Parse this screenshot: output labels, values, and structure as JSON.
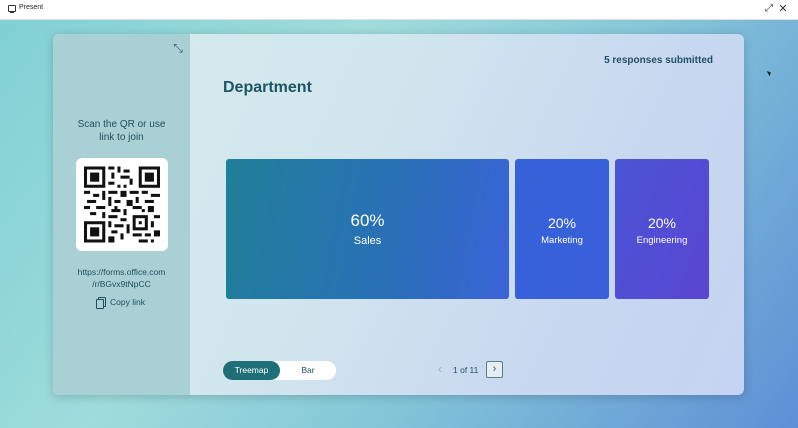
{
  "titlebar": {
    "title": "Present",
    "icons": [
      "present-icon",
      "expand-icon",
      "close-icon"
    ]
  },
  "sidebar": {
    "scan_line1": "Scan the QR or use",
    "scan_line2": "link to join",
    "link_line1": "https://forms.office.com",
    "link_line2": "/r/BGvx9tNpCC",
    "copy_label": "Copy link",
    "icons": [
      "collapse-icon",
      "copy-icon"
    ]
  },
  "main": {
    "responses": "5 responses submitted",
    "question": "Department",
    "tiles": [
      {
        "pct": "60%",
        "label": "Sales",
        "color": "#2a6fb8"
      },
      {
        "pct": "20%",
        "label": "Marketing",
        "color": "#3a5fda"
      },
      {
        "pct": "20%",
        "label": "Engineering",
        "color": "#5a45d2"
      }
    ],
    "toggle": {
      "treemap": "Treemap",
      "bar": "Bar",
      "selected": "Treemap"
    },
    "pager": {
      "text": "1 of 11",
      "icons": [
        "chevron-left-icon",
        "chevron-right-icon"
      ]
    }
  },
  "colors": {
    "accent": "#1f6f78",
    "sidebar_bg": "#a9d0d4",
    "text_dark": "#1d5563"
  }
}
